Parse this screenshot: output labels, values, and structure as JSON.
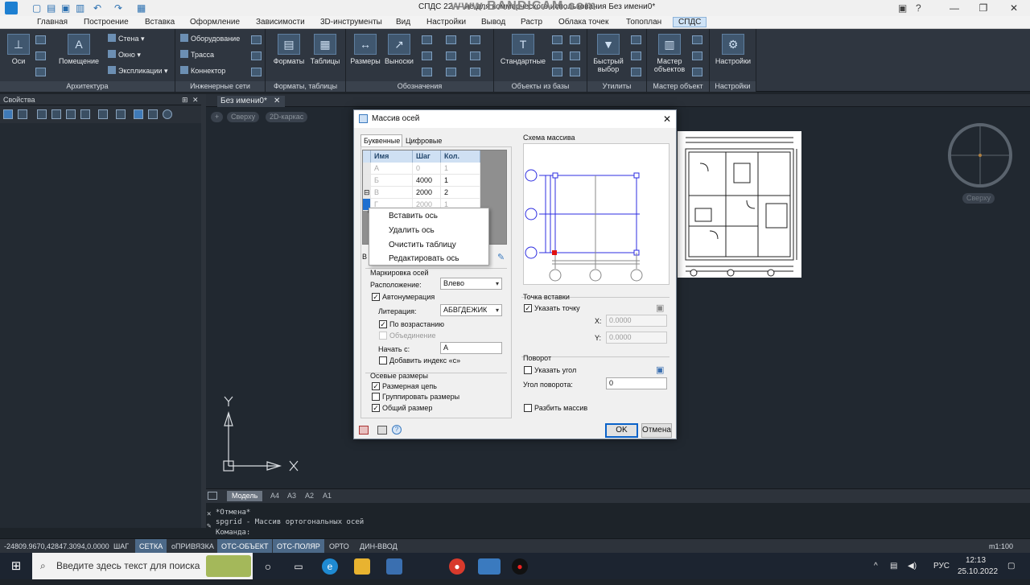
{
  "titlebar": {
    "title": "СПДС 22 — не для коммерческого использования Без имени0*",
    "watermark": "www.BANDICAM.com",
    "minimize": "—",
    "restore": "❐",
    "close": "✕"
  },
  "ribbon_tabs": [
    "Главная",
    "Построение",
    "Вставка",
    "Оформление",
    "Зависимости",
    "3D-инструменты",
    "Вид",
    "Настройки",
    "Вывод",
    "Растр",
    "Облака точек",
    "Топоплан",
    "СПДС"
  ],
  "ribbon_active_tab": "СПДС",
  "ribbon": {
    "arch": {
      "title": "Архитектура",
      "osi": "Оси",
      "room": "Помещение",
      "wall": "Стена",
      "window": "Окно",
      "expl": "Экспликации"
    },
    "eng": {
      "title": "Инженерные сети",
      "equipment": "Оборудование",
      "route": "Трасса",
      "connector": "Коннектор"
    },
    "formats": {
      "title": "Форматы, таблицы",
      "formats": "Форматы",
      "tables": "Таблицы"
    },
    "notation": {
      "title": "Обозначения",
      "dims": "Размеры",
      "leaders": "Выноски"
    },
    "objects": {
      "title": "Объекты из базы",
      "standard": "Стандартные"
    },
    "utils": {
      "title": "Утилиты",
      "quick": "Быстрый выбор"
    },
    "master": {
      "title": "Мастер объект",
      "master": "Мастер объектов"
    },
    "settings": {
      "title": "Настройки",
      "settings": "Настройки"
    }
  },
  "properties": {
    "title": "Свойства"
  },
  "doc_tab": "Без имени0*",
  "viewport": {
    "view": "Сверху",
    "style": "2D-каркас",
    "cube_label": "Сверху",
    "plus": "+"
  },
  "layout_tabs": [
    "Модель",
    "A4",
    "A3",
    "A2",
    "A1"
  ],
  "command": {
    "line1": "*Отмена*",
    "line2": "spgrid - Массив ортогональных осей",
    "prompt": "Команда:"
  },
  "status": {
    "coords": "-24809.9670,42847.3094,0.0000",
    "items": [
      {
        "label": "ШАГ",
        "on": false
      },
      {
        "label": "СЕТКА",
        "on": true
      },
      {
        "label": "оПРИВЯЗКА",
        "on": false
      },
      {
        "label": "ОТС-ОБЪЕКТ",
        "on": true
      },
      {
        "label": "ОТС-ПОЛЯР",
        "on": true
      },
      {
        "label": "ОРТО",
        "on": false
      },
      {
        "label": "ДИН-ВВОД",
        "on": false
      }
    ],
    "scale": "m1:100"
  },
  "taskbar": {
    "search_placeholder": "Введите здесь текст для поиска",
    "lang": "РУС",
    "time": "12:13",
    "date": "25.10.2022"
  },
  "dialog": {
    "title": "Массив осей",
    "tabs": [
      "Буквенные",
      "Цифровые"
    ],
    "table": {
      "headers": [
        "Имя",
        "Шаг",
        "Кол."
      ],
      "rows": [
        [
          "А",
          "0",
          "1"
        ],
        [
          "Б",
          "4000",
          "1"
        ],
        [
          "В",
          "2000",
          "2"
        ],
        [
          "Г",
          "2000",
          "1"
        ]
      ]
    },
    "context_menu": [
      "Вставить ось",
      "Удалить ось",
      "Очистить таблицу",
      "Редактировать ось"
    ],
    "marking": {
      "group": "Маркировка осей",
      "placement_label": "Расположение:",
      "placement_value": "Влево",
      "autonum_label": "Автонумерация",
      "autonum": true,
      "literation_label": "Литерация:",
      "literation_value": "АБВГДЕЖИК",
      "ascending_label": "По возрастанию",
      "ascending": true,
      "merge_label": "Объединение",
      "merge": false,
      "start_label": "Начать с:",
      "start_value": "А",
      "add_index_label": "Добавить индекс «с»",
      "add_index": false
    },
    "dims": {
      "group": "Осевые размеры",
      "chain_label": "Размерная цепь",
      "chain": true,
      "group_dims_label": "Группировать размеры",
      "group_dims": false,
      "total_label": "Общий размер",
      "total": true
    },
    "scheme_label": "Схема массива",
    "insert": {
      "group": "Точка вставки",
      "specify_label": "Указать точку",
      "specify": true,
      "x_label": "X:",
      "x_value": "0.0000",
      "y_label": "Y:",
      "y_value": "0.0000"
    },
    "rotation": {
      "group": "Поворот",
      "specify_label": "Указать угол",
      "specify": false,
      "angle_label": "Угол поворота:",
      "angle_value": "0"
    },
    "split_label": "Разбить массив",
    "split": false,
    "ok": "OK",
    "cancel": "Отмена"
  },
  "colors": {
    "accent": "#0a62c9",
    "ribbon": "#2f3640",
    "canvas": "#212830",
    "axis_line": "#2c2ce0",
    "red_point": "#e01010"
  }
}
